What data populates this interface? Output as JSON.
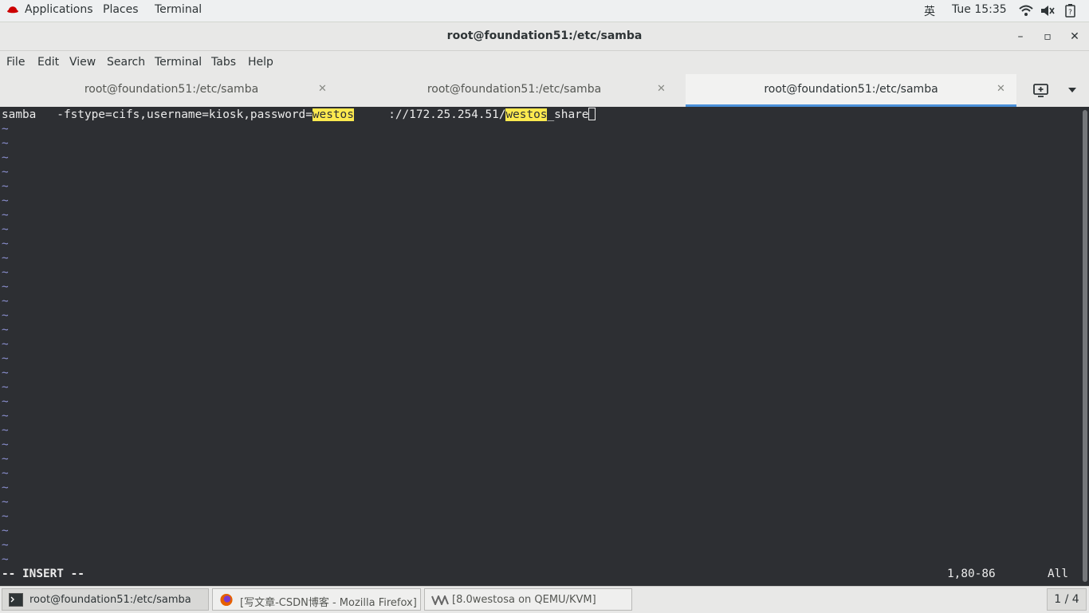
{
  "topbar": {
    "applications": "Applications",
    "places": "Places",
    "terminal": "Terminal",
    "input_method": "英",
    "clock": "Tue 15:35"
  },
  "window": {
    "title": "root@foundation51:/etc/samba"
  },
  "menubar": {
    "items": [
      "File",
      "Edit",
      "View",
      "Search",
      "Terminal",
      "Tabs",
      "Help"
    ]
  },
  "tabs": [
    {
      "label": "root@foundation51:/etc/samba",
      "active": false
    },
    {
      "label": "root@foundation51:/etc/samba",
      "active": false
    },
    {
      "label": "root@foundation51:/etc/samba",
      "active": true
    }
  ],
  "editor": {
    "line1": {
      "part1": "samba   -fstype=cifs,username=kiosk,password=",
      "hl1": "westos",
      "part2": "     ://172.25.254.51/",
      "hl2": "westos",
      "part3": "_share"
    },
    "tilde": "~",
    "mode": "-- INSERT --",
    "position": "1,80-86",
    "scroll": "All"
  },
  "taskbar": {
    "items": [
      {
        "label": "root@foundation51:/etc/samba",
        "active": true
      },
      {
        "label": "[写文章-CSDN博客 - Mozilla Firefox]",
        "active": false
      },
      {
        "label": "[8.0westosa on QEMU/KVM]",
        "active": false
      }
    ],
    "pager": "1 / 4"
  },
  "colors": {
    "terminal_bg": "#2d2f33",
    "highlight": "#fce94f",
    "tab_active_underline": "#4a90d9"
  }
}
